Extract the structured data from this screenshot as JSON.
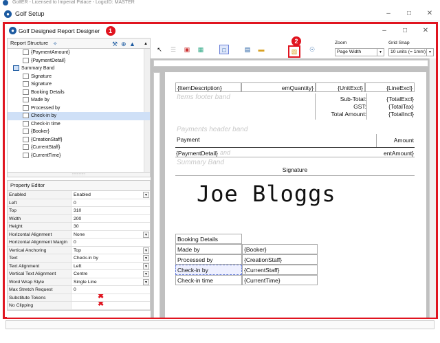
{
  "outer_title": "GolfER - Licensed to Imperial Palace - LogicID: MASTER",
  "setup_window": {
    "title": "Golf Setup"
  },
  "designer": {
    "title": "Golf Designed Report Designer",
    "badge1": "1",
    "badge2": "2"
  },
  "report_structure": {
    "header": "Report Structure",
    "items": [
      {
        "label": "{PaymentAmount}",
        "indent": 2
      },
      {
        "label": "{PaymentDetail}",
        "indent": 2
      },
      {
        "label": "Summary Band",
        "indent": 1
      },
      {
        "label": "Signature",
        "indent": 2
      },
      {
        "label": "Signature",
        "indent": 2
      },
      {
        "label": "Booking Details",
        "indent": 2
      },
      {
        "label": "Made by",
        "indent": 2
      },
      {
        "label": "Processed by",
        "indent": 2
      },
      {
        "label": "Check-in by",
        "indent": 2,
        "selected": true
      },
      {
        "label": "Check-in time",
        "indent": 2
      },
      {
        "label": "{Booker}",
        "indent": 2
      },
      {
        "label": "{CreationStaff}",
        "indent": 2
      },
      {
        "label": "{CurrentStaff}",
        "indent": 2
      },
      {
        "label": "{CurrentTime}",
        "indent": 2
      }
    ]
  },
  "property_editor": {
    "header": "Property Editor",
    "rows": [
      {
        "key": "Enabled",
        "value": "Enabled",
        "dropdown": true
      },
      {
        "key": "Left",
        "value": "0"
      },
      {
        "key": "Top",
        "value": "310"
      },
      {
        "key": "Width",
        "value": "200"
      },
      {
        "key": "Height",
        "value": "30"
      },
      {
        "key": "Horizontal Alignment",
        "value": "None",
        "dropdown": true
      },
      {
        "key": "Horizontal Alignment Margin",
        "value": "0"
      },
      {
        "key": "Vertical Anchoring",
        "value": "Top",
        "dropdown": true
      },
      {
        "key": "Text",
        "value": "Check-in by",
        "dropdown": true
      },
      {
        "key": "Text Alignment",
        "value": "Left",
        "dropdown": true
      },
      {
        "key": "Vertical Text Alignment",
        "value": "Centre",
        "dropdown": true
      },
      {
        "key": "Word Wrap Style",
        "value": "Single Line",
        "dropdown": true
      },
      {
        "key": "Max Stretch Request",
        "value": "0"
      },
      {
        "key": "Substitute Tokens",
        "value": "",
        "redx": true
      },
      {
        "key": "No Clipping",
        "value": "",
        "redx": true
      }
    ]
  },
  "toolbar": {
    "zoom_label": "Zoom",
    "zoom_value": "Page Width",
    "gridsnap_label": "Grid Snap",
    "gridsnap_value": "10 units (= 1mm)"
  },
  "report": {
    "item_description": "{ItemDescription}",
    "item_quantity": "emQuantity}",
    "unit_excl": "{UnitExcl}",
    "line_excl": "{LineExcl}",
    "items_footer_band": "Items footer band",
    "subtotal_label": "Sub-Total:",
    "gst_label": "GST:",
    "total_label": "Total Amount:",
    "total_excl": "{TotalExcl}",
    "total_tax": "{TotalTax}",
    "total_incl": "{TotalIncl}",
    "payments_header_band": "Payments header band",
    "payment_col": "Payment",
    "amount_col": "Amount",
    "payment_detail": "{PaymentDetail}",
    "band_end": "and",
    "payment_amount": "entAmount}",
    "summary_band": "Summary Band",
    "signature_label": "Signature",
    "signature_text": "Joe Bloggs",
    "booking_details": "Booking Details",
    "made_by": "Made by",
    "booker": "{Booker}",
    "processed_by": "Processed by",
    "creation_staff": "{CreationStaff}",
    "checkin_by": "Check-in by",
    "current_staff": "{CurrentStaff}",
    "checkin_time": "Check-in time",
    "current_time": "{CurrentTime}"
  },
  "colors": {
    "highlight": "#e0141f",
    "selection": "#cfe0f7",
    "accent": "#1c5aa0"
  }
}
